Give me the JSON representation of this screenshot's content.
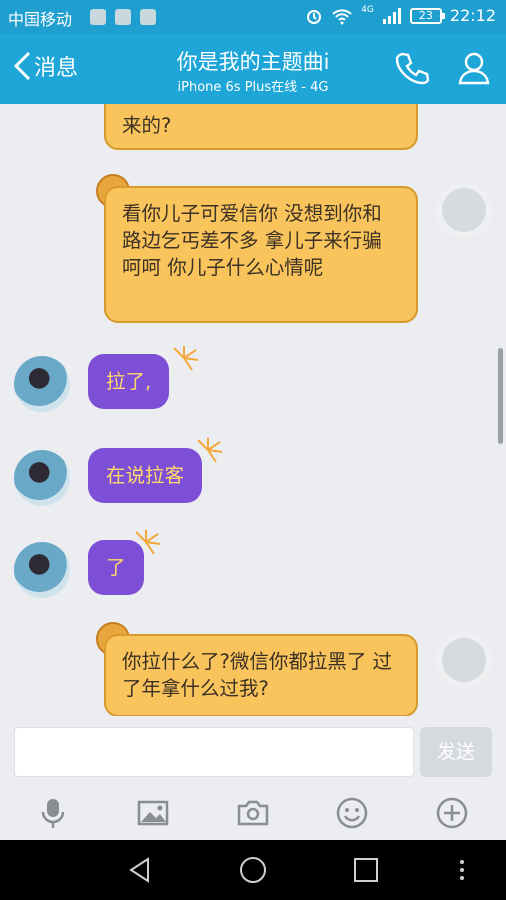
{
  "status_bar": {
    "carrier": "中国移动",
    "network": "4G",
    "battery": "23",
    "time": "22:12"
  },
  "header": {
    "back_label": "消息",
    "title": "你是我的主题曲i",
    "subtitle": "iPhone 6s Plus在线 - 4G"
  },
  "messages": [
    {
      "side": "out",
      "text": "来的?"
    },
    {
      "side": "out",
      "text": "看你儿子可爱信你 没想到你和路边乞丐差不多 拿儿子来行骗 呵呵 你儿子什么心情呢"
    },
    {
      "side": "in",
      "text": "拉了,"
    },
    {
      "side": "in",
      "text": "在说拉客"
    },
    {
      "side": "in",
      "text": "了"
    },
    {
      "side": "out",
      "text": "你拉什么了?微信你都拉黑了 过了年拿什么过我?"
    }
  ],
  "composer": {
    "placeholder": "",
    "send_label": "发送"
  },
  "colors": {
    "accent": "#1ea6d9",
    "out_bubble": "#f8c45b",
    "in_bubble": "#7d4fd6",
    "in_text": "#ffd86b"
  }
}
